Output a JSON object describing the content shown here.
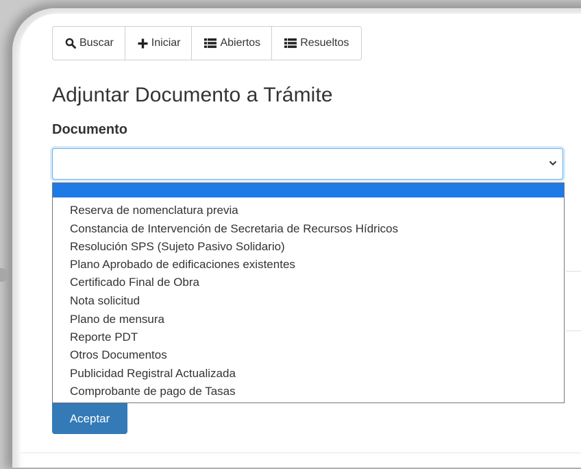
{
  "toolbar": {
    "buttons": [
      {
        "label": "Buscar",
        "icon": "search-icon"
      },
      {
        "label": "Iniciar",
        "icon": "plus-icon"
      },
      {
        "label": "Abiertos",
        "icon": "list-icon"
      },
      {
        "label": "Resueltos",
        "icon": "list-icon"
      }
    ]
  },
  "page": {
    "title": "Adjuntar Documento a Trámite"
  },
  "form": {
    "document_label": "Documento",
    "document_value": "",
    "options": [
      "",
      "Reserva de nomenclatura previa",
      "Constancia de Intervención de Secretaria de Recursos Hídricos",
      "Resolución SPS (Sujeto Pasivo Solidario)",
      "Plano Aprobado de edificaciones existentes",
      "Certificado Final de Obra",
      "Nota solicitud",
      "Plano de mensura",
      "Reporte PDT",
      "Otros Documentos",
      "Publicidad Registral Actualizada",
      "Comprobante de pago de Tasas"
    ],
    "submit_label": "Aceptar"
  },
  "colors": {
    "primary": "#337ab7",
    "highlight": "#1e7ae6",
    "focus_border": "#66afe9",
    "text": "#333333"
  }
}
